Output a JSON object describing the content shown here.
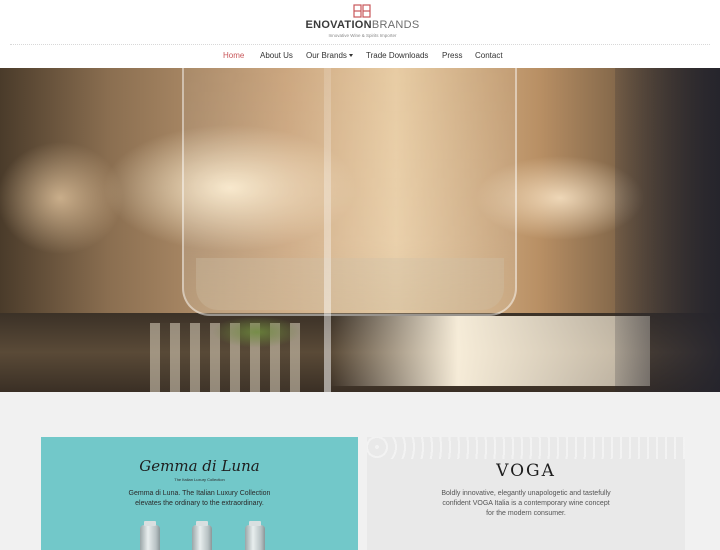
{
  "brand": {
    "name_part1": "ENOVATION",
    "name_part2": "BRANDS",
    "tagline": "Innovative Wine & Spirits Importer",
    "accent_color": "#c8575a"
  },
  "nav": {
    "items": [
      {
        "label": "Home",
        "active": true
      },
      {
        "label": "About Us",
        "active": false
      },
      {
        "label": "Our Brands",
        "active": false,
        "has_dropdown": true
      },
      {
        "label": "Trade Downloads",
        "active": false
      },
      {
        "label": "Press",
        "active": false
      },
      {
        "label": "Contact",
        "active": false
      }
    ]
  },
  "cards": {
    "gemma": {
      "logo": "Gemma di Luna",
      "tagline": "The Italian Luxury Collection",
      "description_line1": "Gemma di Luna. The Italian Luxury Collection",
      "description_line2": "elevates the ordinary to the extraordinary.",
      "background_color": "#72c8c9"
    },
    "voga": {
      "logo": "VOGA",
      "description_line1": "Boldly innovative, elegantly unapologetic and tastefully",
      "description_line2": "confident VOGA Italia is a contemporary wine concept",
      "description_line3": "for the modern consumer.",
      "background_color": "#e9e9e9"
    }
  }
}
